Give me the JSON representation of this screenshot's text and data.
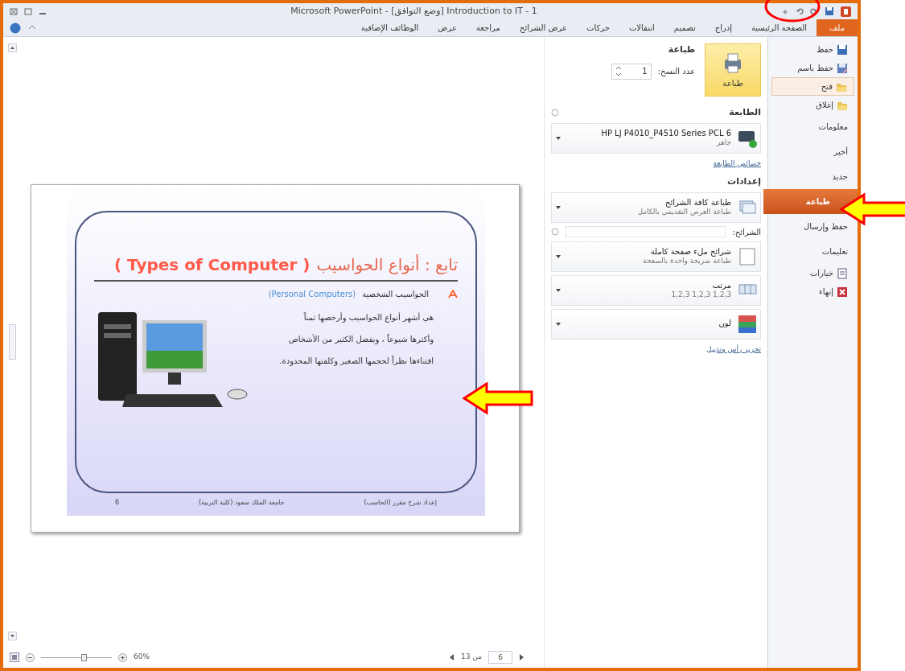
{
  "window": {
    "title": "Microsoft PowerPoint - [وضع التوافق] Introduction to IT - 1"
  },
  "ribbon_tabs": [
    {
      "label": "ملف",
      "selected": true
    },
    {
      "label": "الصفحة الرئيسية",
      "selected": false
    },
    {
      "label": "إدراج",
      "selected": false
    },
    {
      "label": "تصميم",
      "selected": false
    },
    {
      "label": "انتقالات",
      "selected": false
    },
    {
      "label": "حركات",
      "selected": false
    },
    {
      "label": "عرض الشرائح",
      "selected": false
    },
    {
      "label": "مراجعة",
      "selected": false
    },
    {
      "label": "عرض",
      "selected": false
    },
    {
      "label": "الوظائف الإضافية",
      "selected": false
    }
  ],
  "backstage_menu": [
    {
      "label": "حفظ",
      "kind": "icon",
      "selected": false,
      "hovered": false
    },
    {
      "label": "حفظ باسم",
      "kind": "icon",
      "selected": false,
      "hovered": false
    },
    {
      "label": "فتح",
      "kind": "icon",
      "selected": false,
      "hovered": true
    },
    {
      "label": "إغلاق",
      "kind": "icon",
      "selected": false,
      "hovered": false
    },
    {
      "label": "معلومات",
      "kind": "section",
      "selected": false,
      "hovered": false
    },
    {
      "label": "أخير",
      "kind": "section",
      "selected": false,
      "hovered": false
    },
    {
      "label": "جديد",
      "kind": "section",
      "selected": false,
      "hovered": false
    },
    {
      "label": "طباعة",
      "kind": "section",
      "selected": true,
      "hovered": false
    },
    {
      "label": "حفظ وإرسال",
      "kind": "section",
      "selected": false,
      "hovered": false
    },
    {
      "label": "تعليمات",
      "kind": "section",
      "selected": false,
      "hovered": false
    },
    {
      "label": "خيارات",
      "kind": "icon",
      "selected": false,
      "hovered": false
    },
    {
      "label": "إنهاء",
      "kind": "icon",
      "selected": false,
      "hovered": false
    }
  ],
  "print": {
    "heading": "طباعة",
    "print_button": "طباعة",
    "copies_label": "عدد النسخ:",
    "copies": "1",
    "printer_heading": "الطابعة",
    "printer": {
      "name": "HP LJ P4010_P4510 Series PCL 6",
      "status": "جاهز"
    },
    "printer_properties": "خصائص الطابعة",
    "settings_heading": "إعدادات",
    "settings": [
      {
        "kind": "dropdown",
        "title": "طباعة كافة الشرائح",
        "subtitle": "طباعة العرض التقديمي بالكامل"
      },
      {
        "kind": "field",
        "label": "الشرائح:"
      },
      {
        "kind": "dropdown",
        "title": "شرائح ملء صفحة كاملة",
        "subtitle": "طباعة شريحة واحدة بالصفحة"
      },
      {
        "kind": "collate",
        "title": "مرتب",
        "subtitle": "1,2,3    1,2,3    1,2,3"
      },
      {
        "kind": "dropdown",
        "title": "لون"
      }
    ],
    "edit_header_footer": "تحرير رأس وتذييل"
  },
  "preview": {
    "slide": {
      "title_ar": "تابع : أنواع الحواسيب",
      "title_en": "( Types of Computer )",
      "bullet": "الحواسيب الشخصية",
      "bullet_en": "(Personal Computers)",
      "body": [
        "هي أشهر أنواع الحواسيب وأرخصها ثمناً",
        "وأكثرها شيوعاً ، ويفضل الكثير من الأشخاص",
        "اقتناءها نظراً لحجمها الصغير وكلفتها المحدودة."
      ],
      "footer": [
        "إعداد شرح مقرر (الحاسب)",
        "جامعة الملك سعود (كلية التربية)",
        "6"
      ]
    },
    "page_input": "6",
    "page_total": "من 13",
    "zoom": "60%",
    "zoom_slider": {
      "level": 0.62
    }
  }
}
